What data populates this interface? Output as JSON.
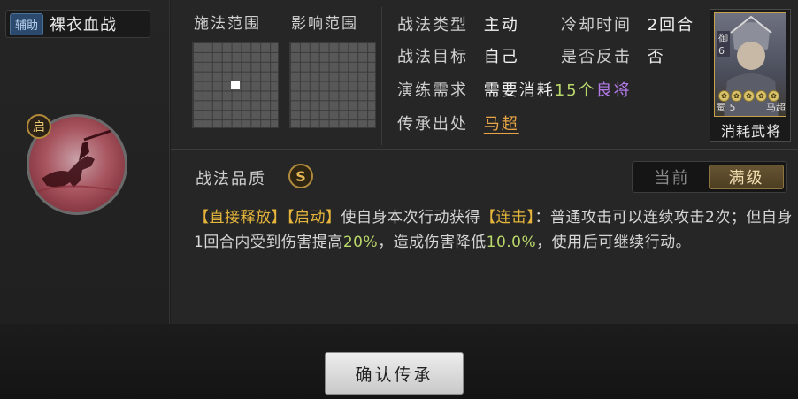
{
  "skill": {
    "tag": "辅助",
    "name": "裸衣血战",
    "icon_badge": "启",
    "icon": "horse-rider-icon"
  },
  "ranges": {
    "cast_title": "施法范围",
    "effect_title": "影响范围"
  },
  "info": {
    "type_label": "战法类型",
    "type_value": "主动",
    "cooldown_label": "冷却时间",
    "cooldown_value": "2回合",
    "target_label": "战法目标",
    "target_value": "自己",
    "counter_label": "是否反击",
    "counter_value": "否",
    "req_label": "演练需求",
    "req_prefix": "需要消耗",
    "req_count": "15个",
    "req_item": "良将",
    "source_label": "传承出处",
    "source_value": "马超"
  },
  "general_card": {
    "faction": "蜀",
    "cost": "5",
    "name": "马超",
    "level_mark": "御",
    "level_num": "6",
    "star_count": 5,
    "caption": "消耗武将"
  },
  "quality": {
    "label": "战法品质",
    "grade": "S"
  },
  "toggle": {
    "current": "当前",
    "max": "满级",
    "active": "max"
  },
  "description": {
    "p1": "【直接释放】",
    "p2": "【启动】",
    "p3": "使自身本次行动获得",
    "p4": "【连击】",
    "p5": "：普通攻击可以连续攻击2次；但自身1回合内受到伤害提高",
    "p6": "20%",
    "p7": "，造成伤害降低",
    "p8": "10.0%",
    "p9": "，使用后可继续行动。"
  },
  "confirm_button": "确认传承",
  "colors": {
    "accent_gold": "#e6b63c",
    "value_green": "#b9d86a",
    "value_purple": "#b27ae6",
    "link_orange": "#e7a548"
  }
}
